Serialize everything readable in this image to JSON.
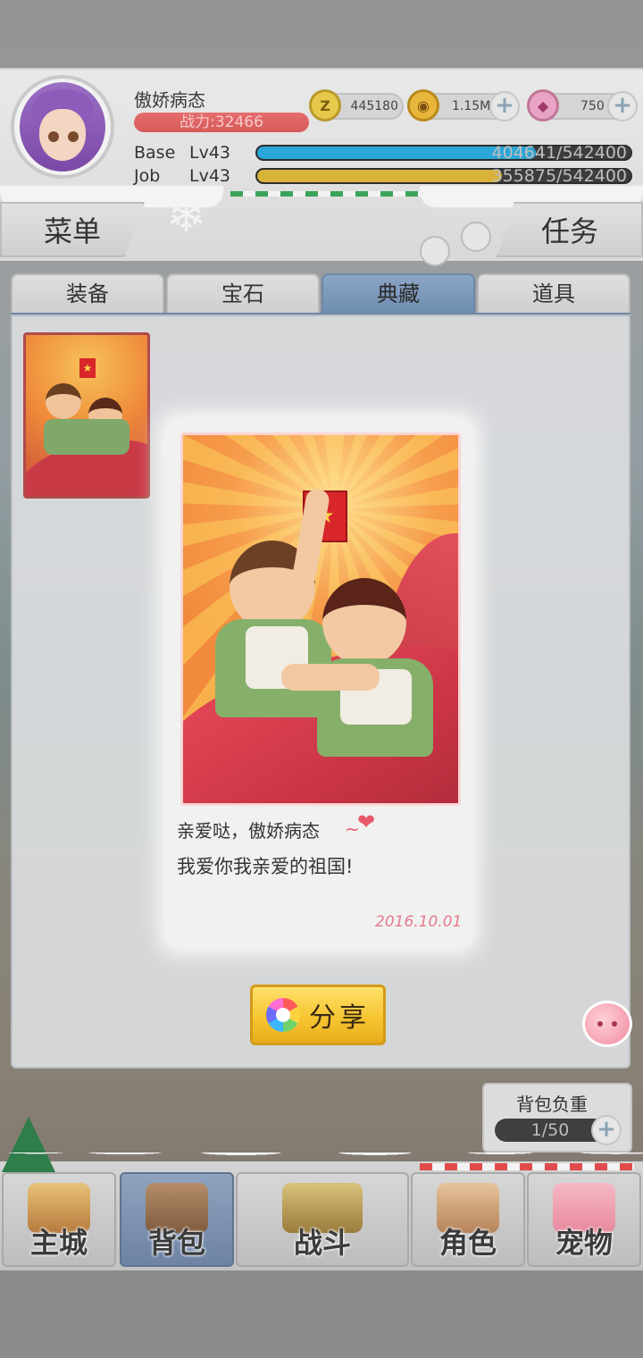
{
  "header": {
    "player_name": "傲娇病态",
    "power_text": "战力:32466",
    "resources": [
      {
        "icon": "zeny-coin-icon",
        "value": "445180",
        "has_plus": false
      },
      {
        "icon": "gold-bag-icon",
        "value": "1.15M",
        "has_plus": true
      },
      {
        "icon": "pink-gem-icon",
        "value": "750",
        "has_plus": true
      }
    ],
    "base": {
      "label": "Base",
      "level": "Lv43",
      "progress_text": "404641/542400",
      "progress_fraction": 0.746,
      "color": "#2aa6d8"
    },
    "job": {
      "label": "Job",
      "level": "Lv43",
      "progress_text": "355875/542400",
      "progress_fraction": 0.656,
      "color": "#d8b23a"
    }
  },
  "side_tabs": {
    "menu": "菜单",
    "task": "任务"
  },
  "tabs": [
    {
      "label": "装备",
      "active": false
    },
    {
      "label": "宝石",
      "active": false
    },
    {
      "label": "典藏",
      "active": true
    },
    {
      "label": "道具",
      "active": false
    }
  ],
  "card": {
    "greeting": "亲爱哒，傲娇病态",
    "tilde": "~",
    "heart": "❤",
    "message": "我爱你我亲爱的祖国!",
    "date": "2016.10.01",
    "book_star": "★"
  },
  "share_button": {
    "label": "分享"
  },
  "capacity": {
    "title": "背包负重",
    "value": "1/50"
  },
  "bottom_nav": [
    {
      "label": "主城",
      "active": false
    },
    {
      "label": "背包",
      "active": true
    },
    {
      "label": "战斗",
      "active": false
    },
    {
      "label": "角色",
      "active": false
    },
    {
      "label": "宠物",
      "active": false
    }
  ],
  "plus_glyph": "+"
}
